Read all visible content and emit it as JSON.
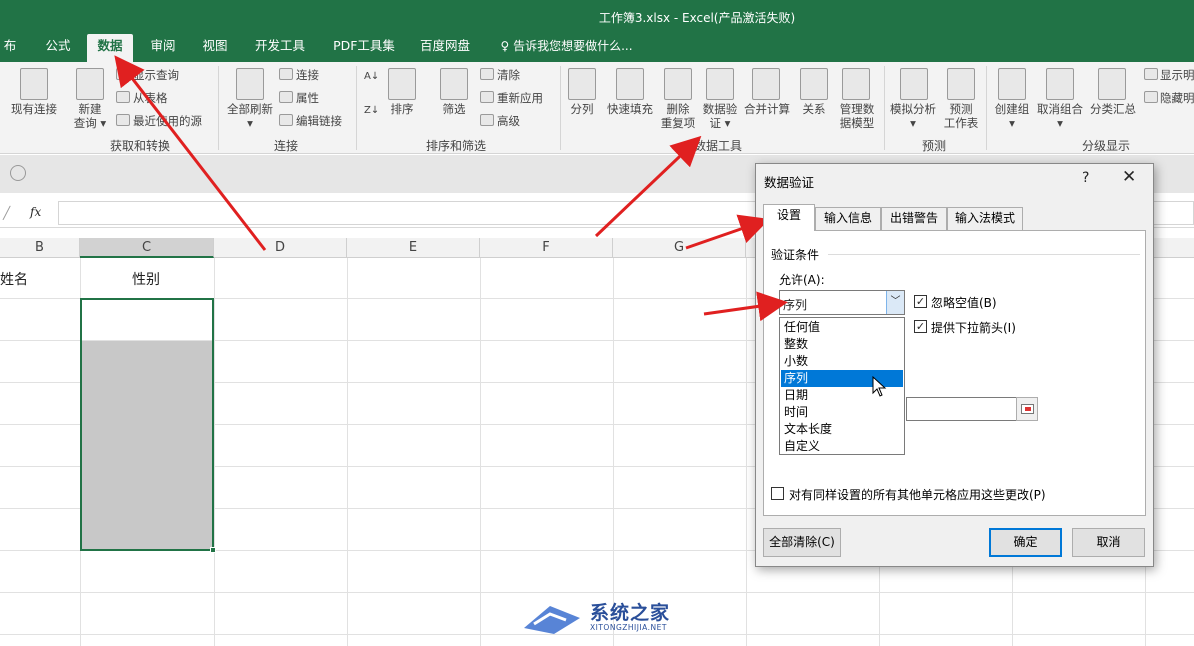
{
  "window": {
    "title": "工作簿3.xlsx - Excel(产品激活失败)"
  },
  "tabs": [
    "布局",
    "公式",
    "数据",
    "审阅",
    "视图",
    "开发工具",
    "PDF工具集",
    "百度网盘"
  ],
  "tell_me": "告诉我您想要做什么...",
  "ribbon": {
    "get_transform": {
      "existing_connections": "现有连接",
      "new_query_1": "新建",
      "new_query_2": "查询",
      "show_queries": "显示查询",
      "from_table": "从表格",
      "recent_sources": "最近使用的源",
      "label": "获取和转换"
    },
    "connections": {
      "refresh_all": "全部刷新",
      "connections": "连接",
      "properties": "属性",
      "edit_links": "编辑链接",
      "label": "连接"
    },
    "sort_filter": {
      "sort": "排序",
      "filter": "筛选",
      "clear": "清除",
      "reapply": "重新应用",
      "advanced": "高级",
      "label": "排序和筛选"
    },
    "data_tools": {
      "split": "分列",
      "flash_fill": "快速填充",
      "remove_dup_1": "删除",
      "remove_dup_2": "重复项",
      "validation_1": "数据验",
      "validation_2": "证",
      "consolidate": "合并计算",
      "relationships": "关系",
      "model_1": "管理数",
      "model_2": "据模型",
      "label": "数据工具"
    },
    "forecast": {
      "whatif": "模拟分析",
      "sheet_1": "预测",
      "sheet_2": "工作表",
      "label": "预测"
    },
    "outline": {
      "group": "创建组",
      "ungroup": "取消组合",
      "subtotal": "分类汇总",
      "show_detail": "显示明",
      "hide_detail": "隐藏明",
      "label": "分级显示"
    }
  },
  "formula_bar": {
    "fx": "fx",
    "cancel": "✕"
  },
  "columns": [
    "B",
    "C",
    "D",
    "E",
    "F",
    "G"
  ],
  "cells": {
    "b1": "姓名",
    "c1": "性别"
  },
  "dialog": {
    "title": "数据验证",
    "help": "?",
    "close": "✕",
    "tabs": [
      "设置",
      "输入信息",
      "出错警告",
      "输入法模式"
    ],
    "criteria_label": "验证条件",
    "allow_label": "允许(A):",
    "allow_value": "序列",
    "ignore_blank": "忽略空值(B)",
    "dropdown_arrow": "提供下拉箭头(I)",
    "options": [
      "任何值",
      "整数",
      "小数",
      "序列",
      "日期",
      "时间",
      "文本长度",
      "自定义"
    ],
    "selected_option": "序列",
    "apply_all": "对有同样设置的所有其他单元格应用这些更改(P)",
    "clear_all": "全部清除(C)",
    "ok": "确定",
    "cancel": "取消"
  },
  "watermark": {
    "name": "系统之家",
    "url": "XITONGZHIJIA.NET"
  },
  "colors": {
    "excel_green": "#217346",
    "arrow_red": "#e02020",
    "selection_blue": "#0078d7"
  }
}
